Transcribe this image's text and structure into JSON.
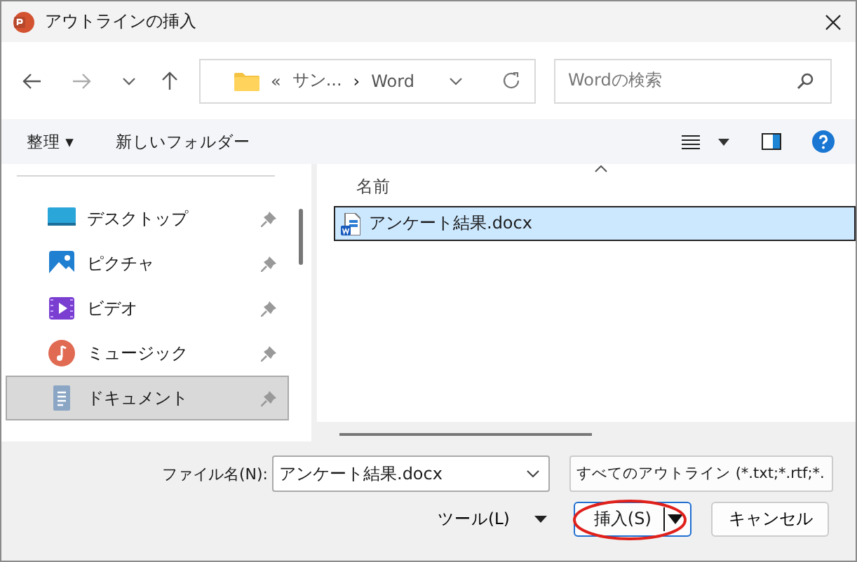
{
  "window": {
    "title": "アウトラインの挿入"
  },
  "address": {
    "parts": [
      "«",
      "サン...",
      "›",
      "Word"
    ]
  },
  "search": {
    "placeholder": "Wordの検索"
  },
  "toolbar": {
    "organize": "整理 ▾",
    "new_folder": "新しいフォルダー"
  },
  "sidebar": {
    "items": [
      {
        "kind": "desktop",
        "label": "デスクトップ",
        "pinned": true,
        "selected": false
      },
      {
        "kind": "pictures",
        "label": "ピクチャ",
        "pinned": true,
        "selected": false
      },
      {
        "kind": "videos",
        "label": "ビデオ",
        "pinned": true,
        "selected": false
      },
      {
        "kind": "music",
        "label": "ミュージック",
        "pinned": true,
        "selected": false
      },
      {
        "kind": "documents",
        "label": "ドキュメント",
        "pinned": true,
        "selected": true
      }
    ]
  },
  "file_list": {
    "columns": [
      "名前"
    ],
    "rows": [
      {
        "name": "アンケート結果.docx",
        "selected": true
      }
    ]
  },
  "footer": {
    "filename_label": "ファイル名(N):",
    "filename_value": "アンケート結果.docx",
    "filter": "すべてのアウトライン (*.txt;*.rtf;*.",
    "tools": "ツール(L)",
    "insert": {
      "label": "挿入(S)",
      "annotated": true
    },
    "cancel": "キャンセル"
  }
}
